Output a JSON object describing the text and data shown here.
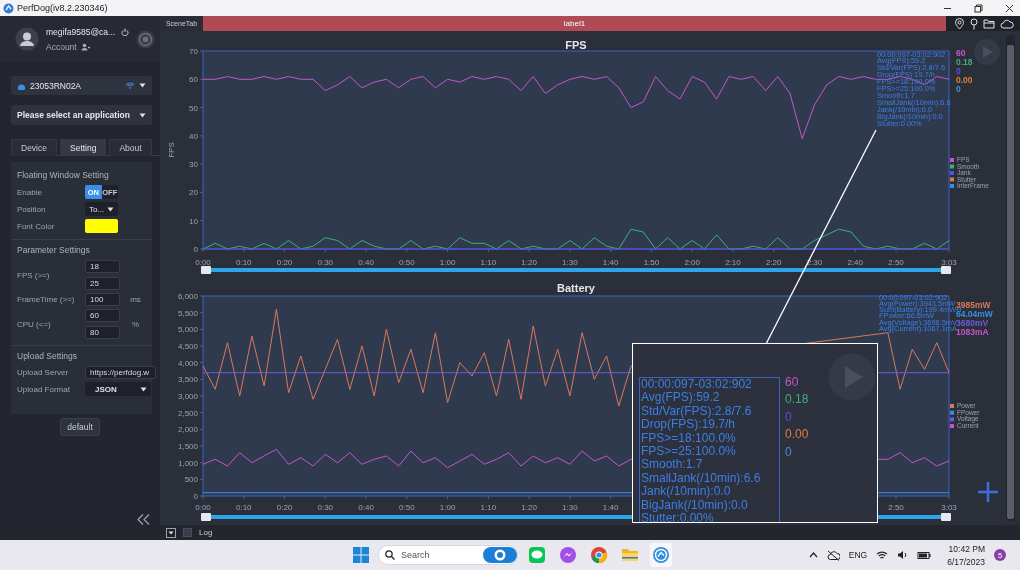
{
  "window": {
    "title": "PerfDog(iv8.2.230346)"
  },
  "account": {
    "user": "megifa9585@ca...",
    "label": "Account"
  },
  "device": {
    "name": "23053RN02A"
  },
  "app_select": {
    "value": "Please select an application"
  },
  "tabs": [
    {
      "label": "Device",
      "selected": false
    },
    {
      "label": "Setting",
      "selected": true
    },
    {
      "label": "About",
      "selected": false
    }
  ],
  "floating": {
    "heading": "Floating Window Setting",
    "enable_label": "Enable",
    "toggle": [
      {
        "label": "ON",
        "selected": true
      },
      {
        "label": "OFF",
        "selected": false
      }
    ],
    "position_label": "Position",
    "position_value": "To...",
    "font_color_label": "Font Color"
  },
  "parameters": {
    "heading": "Parameter Settings",
    "rows": [
      {
        "label": "FPS (>=)",
        "values": [
          "18",
          "25"
        ]
      },
      {
        "label": "FrameTime (>=)",
        "values": [
          "100"
        ],
        "unit": "ms"
      },
      {
        "label": "CPU (<=)",
        "values": [
          "60",
          "80"
        ],
        "unit": "%"
      }
    ]
  },
  "upload": {
    "heading": "Upload Settings",
    "server_label": "Upload Server",
    "server_value": "https://perfdog.w",
    "format_label": "Upload Format",
    "format_value": "JSON"
  },
  "default_button": "default",
  "scene": {
    "tab": "SceneTab",
    "label": "label1"
  },
  "fps_chart": {
    "chart_data": {
      "type": "line",
      "title": "FPS",
      "ylabel": "FPS",
      "legend": "right",
      "xlim": [
        0,
        183
      ],
      "ylim": [
        0,
        70
      ],
      "yticks": [
        0,
        10,
        20,
        30,
        40,
        50,
        60,
        70
      ],
      "xticks": [
        {
          "value": 0,
          "label": "0:00"
        },
        {
          "value": 10,
          "label": "0:10"
        },
        {
          "value": 20,
          "label": "0:20"
        },
        {
          "value": 30,
          "label": "0:30"
        },
        {
          "value": 40,
          "label": "0:40"
        },
        {
          "value": 50,
          "label": "0:50"
        },
        {
          "value": 60,
          "label": "1:00"
        },
        {
          "value": 70,
          "label": "1:10"
        },
        {
          "value": 80,
          "label": "1:20"
        },
        {
          "value": 90,
          "label": "1:30"
        },
        {
          "value": 100,
          "label": "1:40"
        },
        {
          "value": 110,
          "label": "1:50"
        },
        {
          "value": 120,
          "label": "2:00"
        },
        {
          "value": 130,
          "label": "2:10"
        },
        {
          "value": 140,
          "label": "2:20"
        },
        {
          "value": 150,
          "label": "2:30"
        },
        {
          "value": 160,
          "label": "2:40"
        },
        {
          "value": 170,
          "label": "2:50"
        },
        {
          "value": 183,
          "label": "3:03"
        }
      ],
      "x": [
        0,
        3,
        6,
        9,
        12,
        15,
        18,
        21,
        24,
        27,
        30,
        33,
        36,
        39,
        42,
        45,
        48,
        51,
        54,
        57,
        60,
        63,
        66,
        69,
        72,
        75,
        78,
        81,
        84,
        87,
        90,
        93,
        96,
        99,
        102,
        105,
        108,
        111,
        114,
        117,
        120,
        123,
        126,
        129,
        132,
        135,
        138,
        141,
        144,
        147,
        150,
        153,
        156,
        159,
        162,
        165,
        168,
        171,
        174,
        177,
        180,
        183
      ],
      "series": [
        {
          "name": "FPS",
          "color": "#c455cc",
          "values": [
            60,
            60,
            61,
            60,
            60,
            61,
            60,
            61,
            60,
            60,
            56,
            58,
            61,
            57,
            59,
            60,
            57,
            60,
            61,
            57,
            60,
            59,
            61,
            60,
            61,
            60,
            56,
            61,
            55,
            58,
            60,
            61,
            60,
            61,
            57,
            50,
            52,
            61,
            56,
            53,
            61,
            59,
            53,
            61,
            60,
            61,
            56,
            61,
            55,
            39,
            51,
            58,
            61,
            60,
            61,
            60,
            60,
            61,
            60,
            58,
            61,
            60
          ]
        },
        {
          "name": "Smooth",
          "color": "#3fae7a",
          "values": [
            0,
            2,
            0,
            1,
            0,
            2,
            0,
            3,
            0,
            1,
            4,
            3,
            0,
            3,
            1,
            0,
            0,
            3,
            0,
            1,
            0,
            4,
            2,
            2,
            0,
            3,
            0,
            1,
            0,
            0,
            3,
            0,
            4,
            1,
            0,
            7,
            6,
            0,
            4,
            0,
            3,
            0,
            5,
            0,
            0,
            1,
            0,
            4,
            0,
            0,
            3,
            5,
            7,
            6,
            1,
            0,
            1,
            0,
            0,
            2,
            0,
            3
          ]
        },
        {
          "name": "Jank",
          "color": "#5a4fe0",
          "values": [
            0,
            0,
            0,
            0,
            0,
            0,
            0,
            0,
            0,
            0,
            0,
            0,
            0,
            0,
            0,
            0,
            0,
            0,
            0,
            0,
            0,
            0,
            0,
            0,
            0,
            0,
            0,
            0,
            0,
            0,
            0,
            0,
            0,
            0,
            0,
            0,
            0,
            0,
            0,
            0,
            0,
            0,
            0,
            0,
            0,
            0,
            0,
            0,
            0,
            0,
            0,
            0,
            0,
            0,
            0,
            0,
            0,
            0,
            0,
            0,
            0,
            0
          ]
        },
        {
          "name": "Stutter",
          "color": "#e07a3a",
          "values": [
            null,
            null,
            null,
            null,
            null,
            null,
            null,
            null,
            null,
            null,
            null,
            null,
            null,
            null,
            null,
            null,
            null,
            null,
            null,
            null,
            null,
            null,
            null,
            null,
            null,
            null,
            null,
            null,
            null,
            null,
            null,
            null,
            null,
            null,
            null,
            null,
            null,
            null,
            null,
            null,
            null,
            null,
            null,
            null,
            null,
            null,
            null,
            null,
            null,
            null,
            null,
            null,
            null,
            null,
            null,
            null,
            null,
            null,
            null,
            null,
            null,
            null
          ]
        },
        {
          "name": "InterFrame",
          "color": "#3a8ee0",
          "values": [
            null,
            null,
            null,
            null,
            null,
            null,
            null,
            null,
            null,
            null,
            null,
            null,
            null,
            null,
            null,
            null,
            null,
            null,
            null,
            null,
            null,
            null,
            null,
            null,
            null,
            null,
            null,
            null,
            null,
            null,
            null,
            null,
            null,
            null,
            null,
            null,
            null,
            null,
            null,
            null,
            null,
            null,
            null,
            null,
            null,
            null,
            null,
            null,
            null,
            null,
            null,
            null,
            null,
            null,
            null,
            null,
            null,
            null,
            null,
            null,
            null,
            null
          ]
        }
      ]
    },
    "stats": [
      "00:00:097-03:02:902",
      "Avg(FPS):59.2",
      "Std/Var(FPS):2.8/7.6",
      "Drop(FPS):19.7/h",
      "FPS>=18:100.0%",
      "FPS>=25:100.0%",
      "Smooth:1.7",
      "SmallJank(/10min):6.6",
      "Jank(/10min):0.0",
      "BigJank(/10min):0.0",
      "Stutter:0.00%"
    ],
    "readings": [
      {
        "text": "60",
        "color": "#c455cc"
      },
      {
        "text": "0.18",
        "color": "#3fae7a"
      },
      {
        "text": "0",
        "color": "#5a4fe0"
      },
      {
        "text": "0.00",
        "color": "#e07a3a"
      },
      {
        "text": "0",
        "color": "#3a8ee0"
      }
    ]
  },
  "battery_chart": {
    "chart_data": {
      "type": "line",
      "title": "Battery",
      "legend": "right",
      "xlim": [
        0,
        183
      ],
      "ylim": [
        0,
        6000
      ],
      "yticks": [
        {
          "value": 0,
          "label": "0"
        },
        {
          "value": 500,
          "label": "500"
        },
        {
          "value": 1000,
          "label": "1,000"
        },
        {
          "value": 1500,
          "label": "1,500"
        },
        {
          "value": 2000,
          "label": "2,000"
        },
        {
          "value": 2500,
          "label": "2,500"
        },
        {
          "value": 3000,
          "label": "3,000"
        },
        {
          "value": 3500,
          "label": "3,500"
        },
        {
          "value": 4000,
          "label": "4,000"
        },
        {
          "value": 4500,
          "label": "4,500"
        },
        {
          "value": 5000,
          "label": "5,000"
        },
        {
          "value": 5500,
          "label": "5,500"
        },
        {
          "value": 6000,
          "label": "6,000"
        }
      ],
      "xticks": [
        {
          "value": 0,
          "label": "0:00"
        },
        {
          "value": 10,
          "label": "0:10"
        },
        {
          "value": 20,
          "label": "0:20"
        },
        {
          "value": 30,
          "label": "0:30"
        },
        {
          "value": 40,
          "label": "0:40"
        },
        {
          "value": 50,
          "label": "0:50"
        },
        {
          "value": 60,
          "label": "1:00"
        },
        {
          "value": 70,
          "label": "1:10"
        },
        {
          "value": 80,
          "label": "1:20"
        },
        {
          "value": 90,
          "label": "1:30"
        },
        {
          "value": 100,
          "label": "1:40"
        },
        {
          "value": 170,
          "label": "2:50"
        },
        {
          "value": 183,
          "label": "3:03"
        }
      ],
      "x": [
        0,
        3,
        6,
        9,
        12,
        15,
        18,
        21,
        24,
        27,
        30,
        33,
        36,
        39,
        42,
        45,
        48,
        51,
        54,
        57,
        60,
        63,
        66,
        69,
        72,
        75,
        78,
        81,
        84,
        87,
        90,
        93,
        96,
        99,
        102,
        105,
        168,
        171,
        174,
        177,
        180,
        183
      ],
      "series": [
        {
          "name": "Power",
          "color": "#d9785a",
          "values": [
            3900,
            3200,
            4600,
            3000,
            4800,
            3300,
            5600,
            3100,
            4200,
            2900,
            3800,
            4700,
            3200,
            4500,
            3000,
            5000,
            3400,
            4400,
            3100,
            4900,
            2800,
            4000,
            3600,
            4300,
            3000,
            4700,
            2900,
            5100,
            3300,
            4400,
            3000,
            4900,
            3500,
            4200,
            2700,
            3900,
            4900,
            3200,
            4400,
            3800,
            4600,
            3700
          ]
        },
        {
          "name": "FPower",
          "color": "#3a8ee0",
          "values": [
            100,
            100,
            100,
            100,
            100,
            100,
            100,
            100,
            100,
            100,
            100,
            100,
            100,
            100,
            100,
            100,
            100,
            100,
            100,
            100,
            100,
            100,
            100,
            100,
            100,
            100,
            100,
            100,
            100,
            100,
            100,
            100,
            100,
            100,
            100,
            100,
            100,
            100,
            100,
            100,
            100,
            100
          ]
        },
        {
          "name": "Voltage",
          "color": "#6a5ad8",
          "values": [
            3700,
            3700,
            3700,
            3700,
            3700,
            3700,
            3700,
            3700,
            3700,
            3700,
            3700,
            3700,
            3700,
            3700,
            3700,
            3700,
            3700,
            3700,
            3700,
            3700,
            3700,
            3700,
            3700,
            3700,
            3700,
            3700,
            3700,
            3700,
            3700,
            3700,
            3700,
            3700,
            3700,
            3700,
            3700,
            3700,
            3700,
            3700,
            3700,
            3700,
            3700,
            3700
          ]
        },
        {
          "name": "Current",
          "color": "#c455cc",
          "values": [
            950,
            1100,
            900,
            1300,
            1000,
            1200,
            1400,
            950,
            1150,
            900,
            1250,
            1000,
            1300,
            950,
            1100,
            1200,
            900,
            1350,
            1000,
            1150,
            850,
            1050,
            1250,
            950,
            1100,
            1300,
            900,
            1200,
            1000,
            1150,
            950,
            1350,
            1050,
            1200,
            900,
            1100,
            1100,
            1300,
            1000,
            1150,
            900,
            1050
          ]
        }
      ]
    },
    "stats": [
      "00:00:097-03:02:902",
      "Avg(Power):3943.5mW",
      "Sum(Battery):199.4mWH",
      "FPower:66.6mW",
      "Avg(Voltage):3696.5mV",
      "Avg(Current):1067.1mA"
    ],
    "readings": [
      {
        "text": "3985mW",
        "color": "#d9785a"
      },
      {
        "text": "64.04mW",
        "color": "#3a8ee0"
      },
      {
        "text": "3680mV",
        "color": "#6a5ad8"
      },
      {
        "text": "1083mA",
        "color": "#c455cc"
      }
    ]
  },
  "magnifier": {
    "stats": [
      "00:00:097-03:02:902",
      "Avg(FPS):59.2",
      "Std/Var(FPS):2.8/7.6",
      "Drop(FPS):19.7/h",
      "FPS>=18:100.0%",
      "FPS>=25:100.0%",
      "Smooth:1.7",
      "SmallJank(/10min):6.6",
      "Jank(/10min):0.0",
      "BigJank(/10min):0.0",
      "Stutter:0.00%"
    ],
    "readings": [
      {
        "text": "60",
        "color": "#c455cc"
      },
      {
        "text": "0.18",
        "color": "#3fae7a"
      },
      {
        "text": "0",
        "color": "#5a4fe0"
      },
      {
        "text": "0.00",
        "color": "#e07a3a"
      },
      {
        "text": "0",
        "color": "#3a8ee0"
      }
    ]
  },
  "log": {
    "label": "Log",
    "checked": false
  },
  "taskbar": {
    "search_placeholder": "Search",
    "language": "ENG",
    "time": "10:42 PM",
    "date": "6/17/2023",
    "badge": "5"
  }
}
